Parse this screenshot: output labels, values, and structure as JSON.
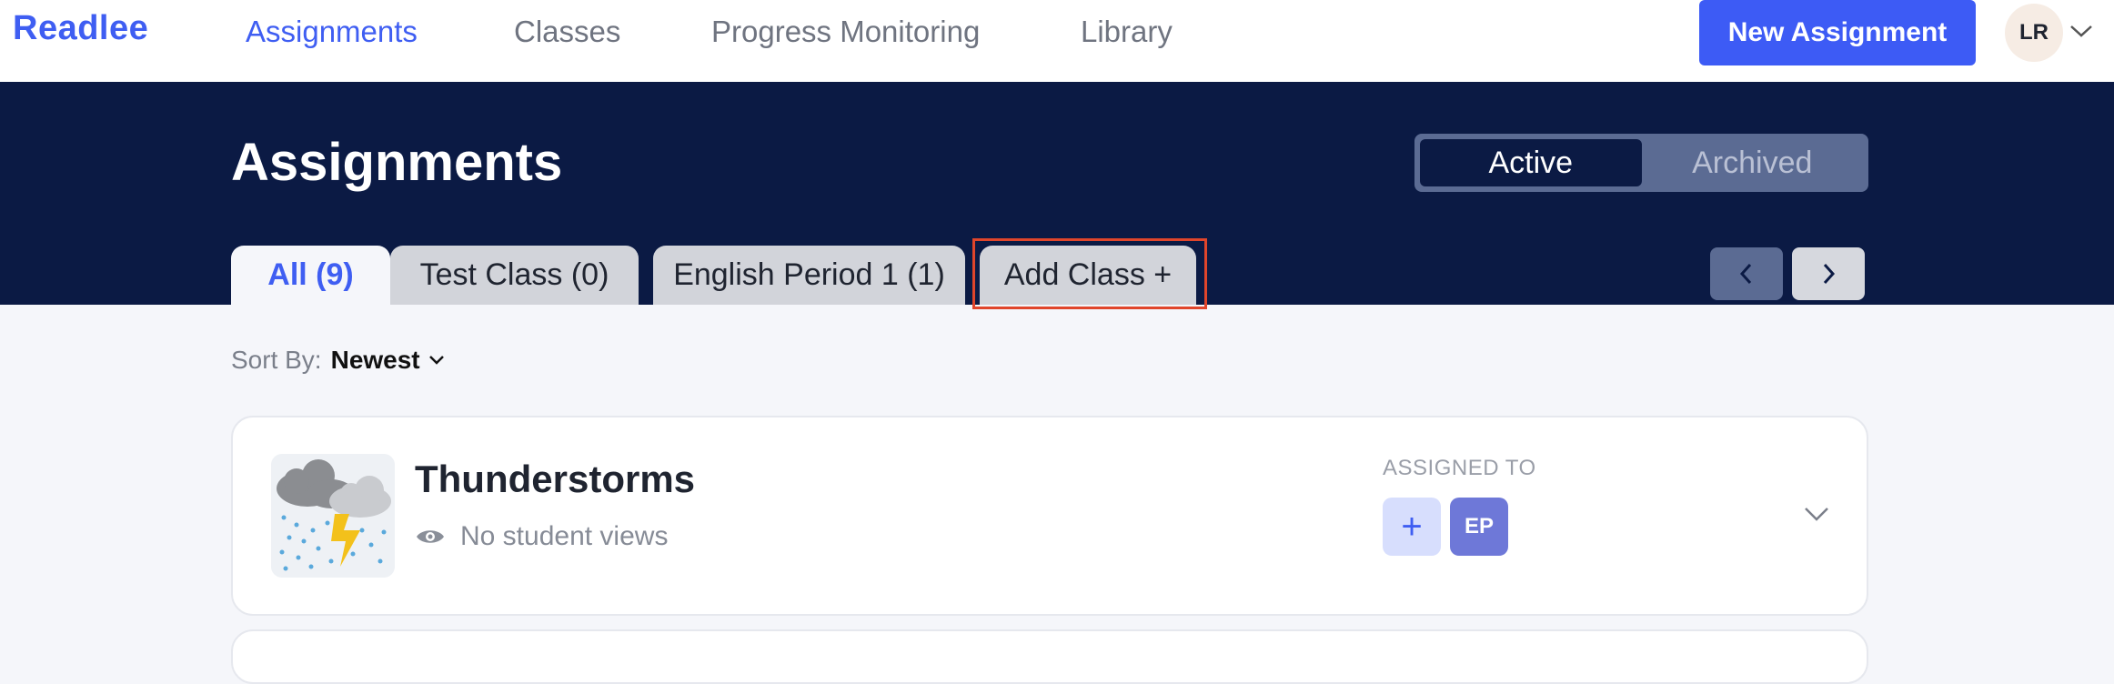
{
  "brand": {
    "logo": "Readlee"
  },
  "nav": {
    "items": [
      {
        "label": "Assignments",
        "active": true
      },
      {
        "label": "Classes",
        "active": false
      },
      {
        "label": "Progress Monitoring",
        "active": false
      },
      {
        "label": "Library",
        "active": false
      }
    ],
    "new_assignment_label": "New Assignment",
    "avatar_initials": "LR"
  },
  "header": {
    "title": "Assignments",
    "toggle": {
      "active": "Active",
      "archived": "Archived"
    },
    "tabs": [
      {
        "label": "All (9)",
        "active": true
      },
      {
        "label": "Test Class (0)",
        "active": false
      },
      {
        "label": "English Period 1 (1)",
        "active": false
      },
      {
        "label": "Add Class +",
        "active": false
      }
    ]
  },
  "sort": {
    "label": "Sort By:",
    "value": "Newest"
  },
  "assignments": [
    {
      "title": "Thunderstorms",
      "views": "No student views",
      "assigned_label": "ASSIGNED TO",
      "add_symbol": "+",
      "classes": [
        "EP"
      ]
    }
  ],
  "colors": {
    "accent": "#3f5ef2",
    "header_bg": "#0b1a44",
    "highlight": "#e0452b"
  }
}
